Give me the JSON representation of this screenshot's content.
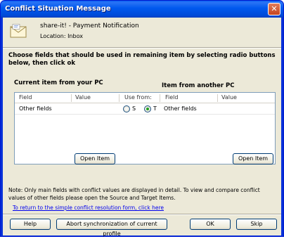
{
  "window": {
    "title": "Conflict Situation Message",
    "close_glyph": "✕"
  },
  "header": {
    "icon": "mail-envelope-icon",
    "subject": "share-it! - Payment Notification",
    "location": "Location:  Inbox"
  },
  "instruction": "Choose fields that should be used in remaining item by selecting radio buttons below, then click ok",
  "left_column_title": "Current item from your PC",
  "right_column_title": "Item from another PC",
  "grid": {
    "headers": {
      "field": "Field",
      "value": "Value",
      "use_from": "Use from:",
      "field2": "Field",
      "value2": "Value"
    },
    "rows": [
      {
        "field": "Other fields",
        "radio_s_label": "S",
        "radio_t_label": "T",
        "selected": "T",
        "field2": "Other fields"
      }
    ]
  },
  "buttons": {
    "open_item_left": "Open Item",
    "open_item_right": "Open Item",
    "help": "Help",
    "abort": "Abort synchronization of current profile",
    "ok": "OK",
    "skip": "Skip"
  },
  "note": "Note: Only main fields with conflict values are displayed in detail. To view and compare conflict values of other fields please open the Source and Target Items.",
  "link": "To return to the simple conflict resolution form, click here"
}
